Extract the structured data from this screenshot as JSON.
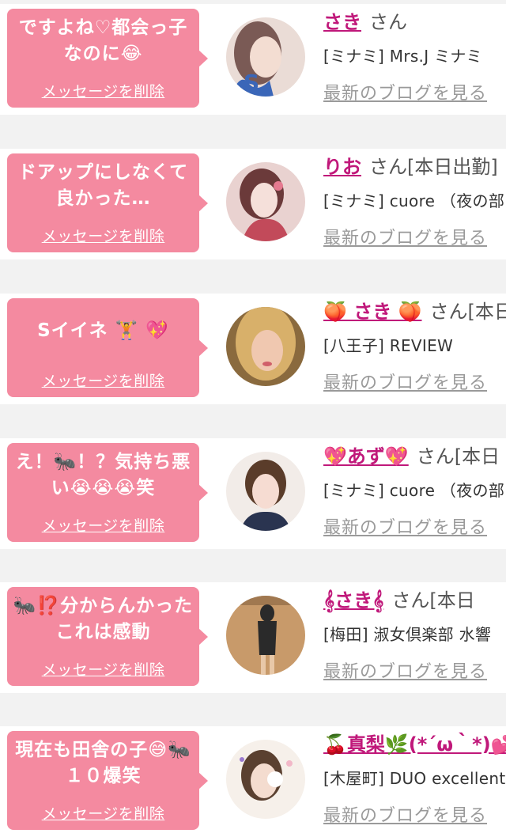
{
  "items": [
    {
      "message": "ですよね♡都会っ子なのに😂",
      "delete_label": "メッセージを削除",
      "name": "さき",
      "suffix": "さん",
      "store": "[ミナミ] Mrs.J ミナミ",
      "blog_label": "最新のブログを見る",
      "avatar_colors": [
        "#eadcd6",
        "#7a5a55",
        "#3a66b8"
      ]
    },
    {
      "message": "ドアップにしなくて良かった…",
      "delete_label": "メッセージを削除",
      "name": "りお",
      "suffix": "さん[本日出勤]",
      "store": "[ミナミ] cuore （夜の部",
      "blog_label": "最新のブログを見る",
      "avatar_colors": [
        "#e9d2d0",
        "#6b3a3a",
        "#c24a5a"
      ]
    },
    {
      "message": "Sイイネ 🏋 💖",
      "delete_label": "メッセージを削除",
      "name": "🍑 さき 🍑",
      "suffix": "さん[本日",
      "store": "[八王子] REVIEW",
      "blog_label": "最新のブログを見る",
      "avatar_colors": [
        "#8a6a3e",
        "#d8b06a",
        "#f0c8b0"
      ]
    },
    {
      "message": "え！🐜！？気持ち悪い😭😭😭笑",
      "delete_label": "メッセージを削除",
      "name": "💖あず💖",
      "suffix": "さん[本日",
      "store": "[ミナミ] cuore （夜の部",
      "blog_label": "最新のブログを見る",
      "avatar_colors": [
        "#f2ece8",
        "#5a3c2a",
        "#2a3450"
      ]
    },
    {
      "message": "🐜⁉️分からんかったこれは感動",
      "delete_label": "メッセージを削除",
      "name": "𝄞さき𝄞",
      "suffix": "さん[本日",
      "store": "[梅田] 淑女倶楽部 水響",
      "blog_label": "最新のブログを見る",
      "avatar_colors": [
        "#c89a6a",
        "#2a2a2a",
        "#e8c8a8"
      ]
    },
    {
      "message": "現在も田舎の子😅🐜１０爆笑",
      "delete_label": "メッセージを削除",
      "name": "🍒真梨🌿(*´ω｀*)💕",
      "suffix": "",
      "store": "[木屋町] DUO excellent",
      "blog_label": "最新のブログを見る",
      "avatar_colors": [
        "#f6f0ea",
        "#5a4030",
        "#f2b8c8"
      ]
    }
  ]
}
